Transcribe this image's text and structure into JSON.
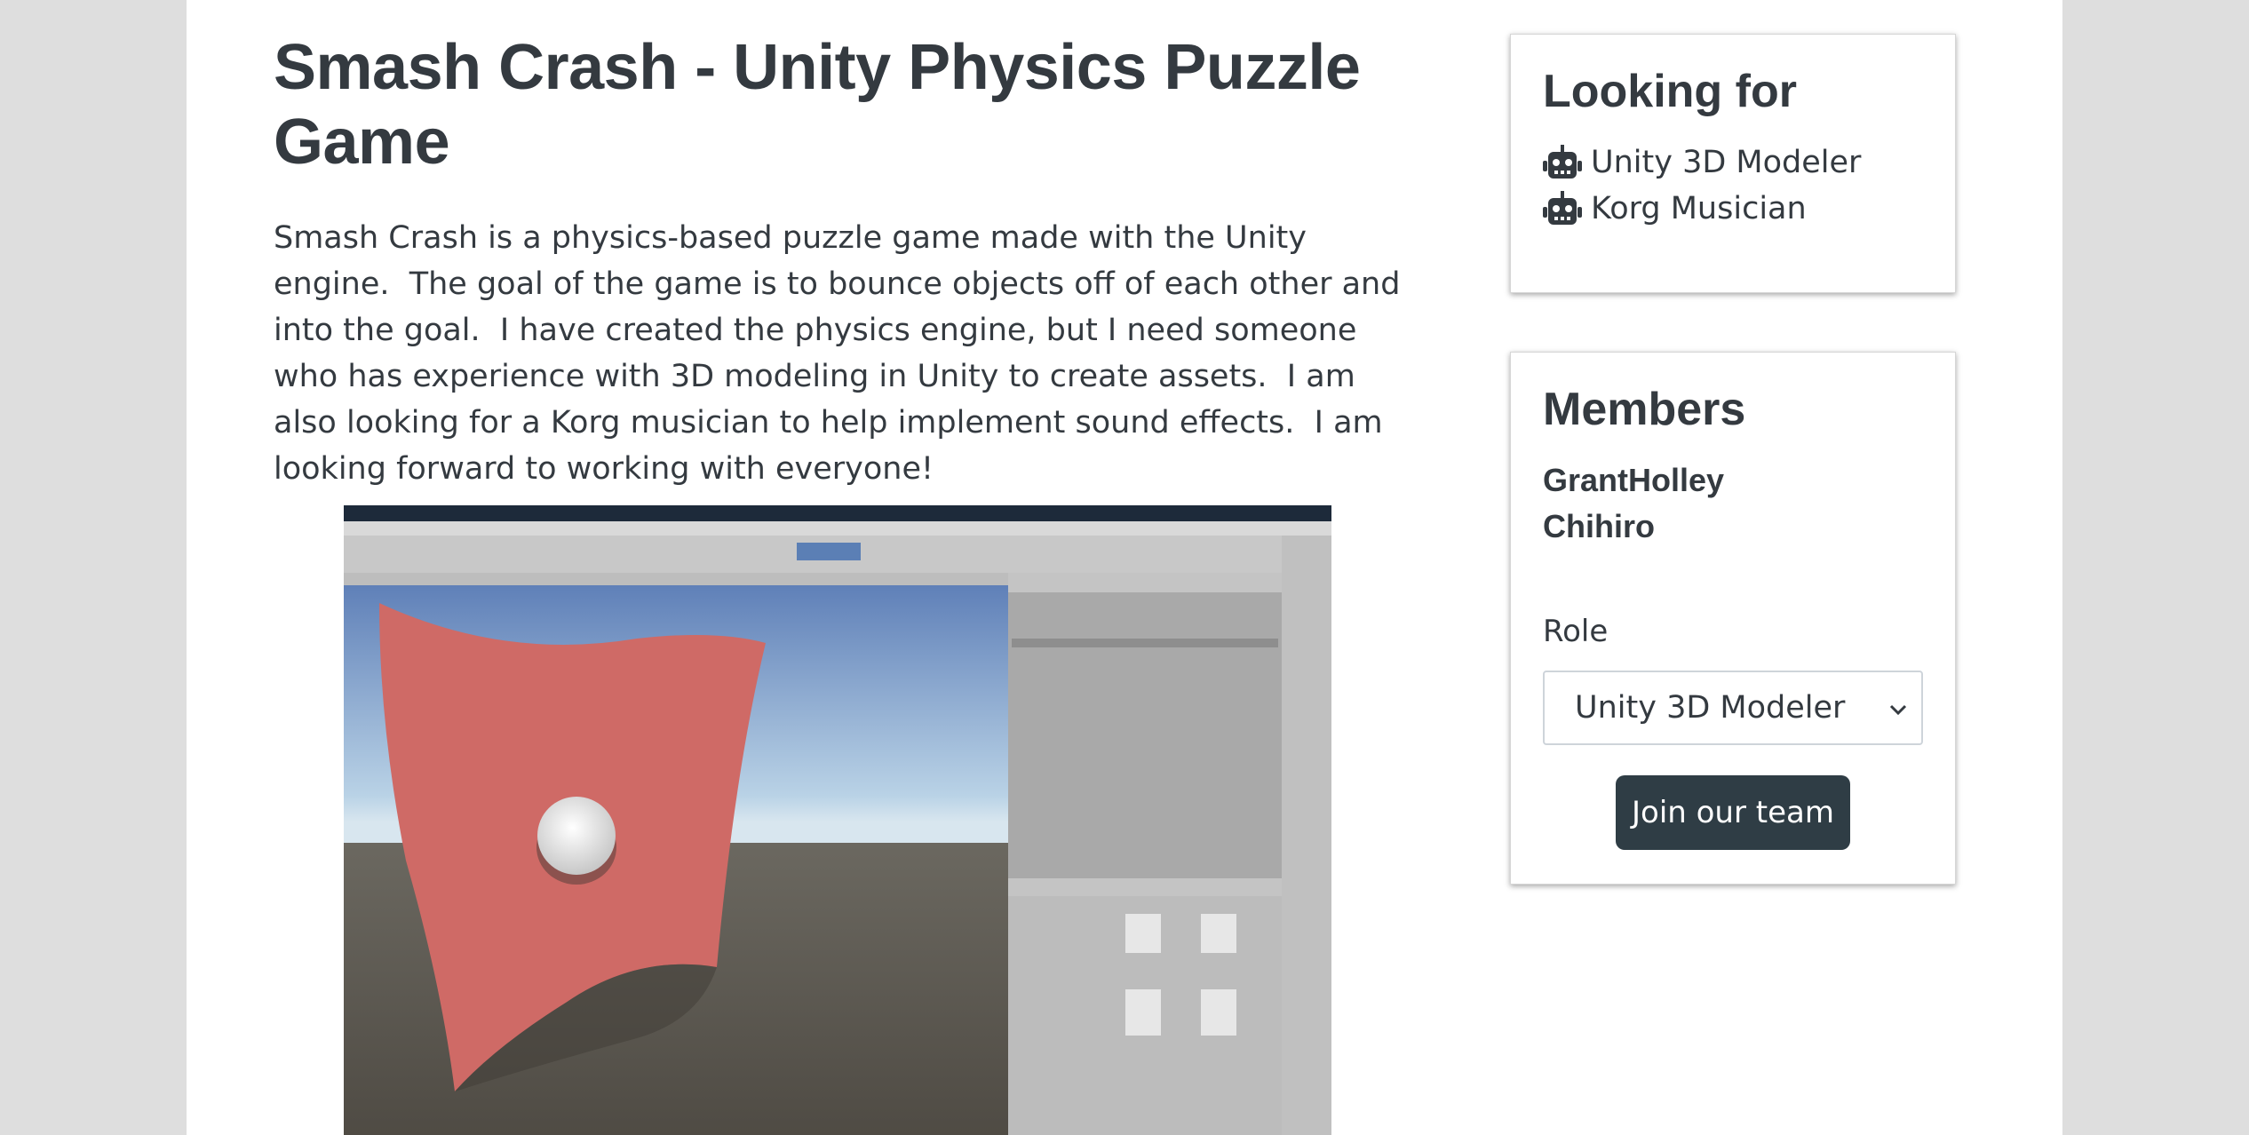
{
  "project": {
    "title": "Smash Crash - Unity Physics Puzzle Game",
    "description": "Smash Crash is a physics-based puzzle game made with the Unity engine.  The goal of the game is to bounce objects off of each other and into the goal.  I have created the physics engine, but I need someone who has experience with 3D modeling in Unity to create assets.  I am also looking for a Korg musician to help implement sound effects.  I am looking forward to working with everyone!"
  },
  "looking_for": {
    "title": "Looking for",
    "roles": [
      {
        "icon": "robot-icon",
        "label": "Unity 3D Modeler"
      },
      {
        "icon": "robot-icon",
        "label": "Korg Musician"
      }
    ]
  },
  "members": {
    "title": "Members",
    "list": [
      "GrantHolley",
      "Chihiro"
    ],
    "role_label": "Role",
    "role_selected": "Unity 3D Modeler",
    "join_label": "Join our team"
  },
  "colors": {
    "text": "#343a40",
    "button": "#2f3d45",
    "page_bg": "#dedede",
    "card_bg": "#ffffff"
  }
}
